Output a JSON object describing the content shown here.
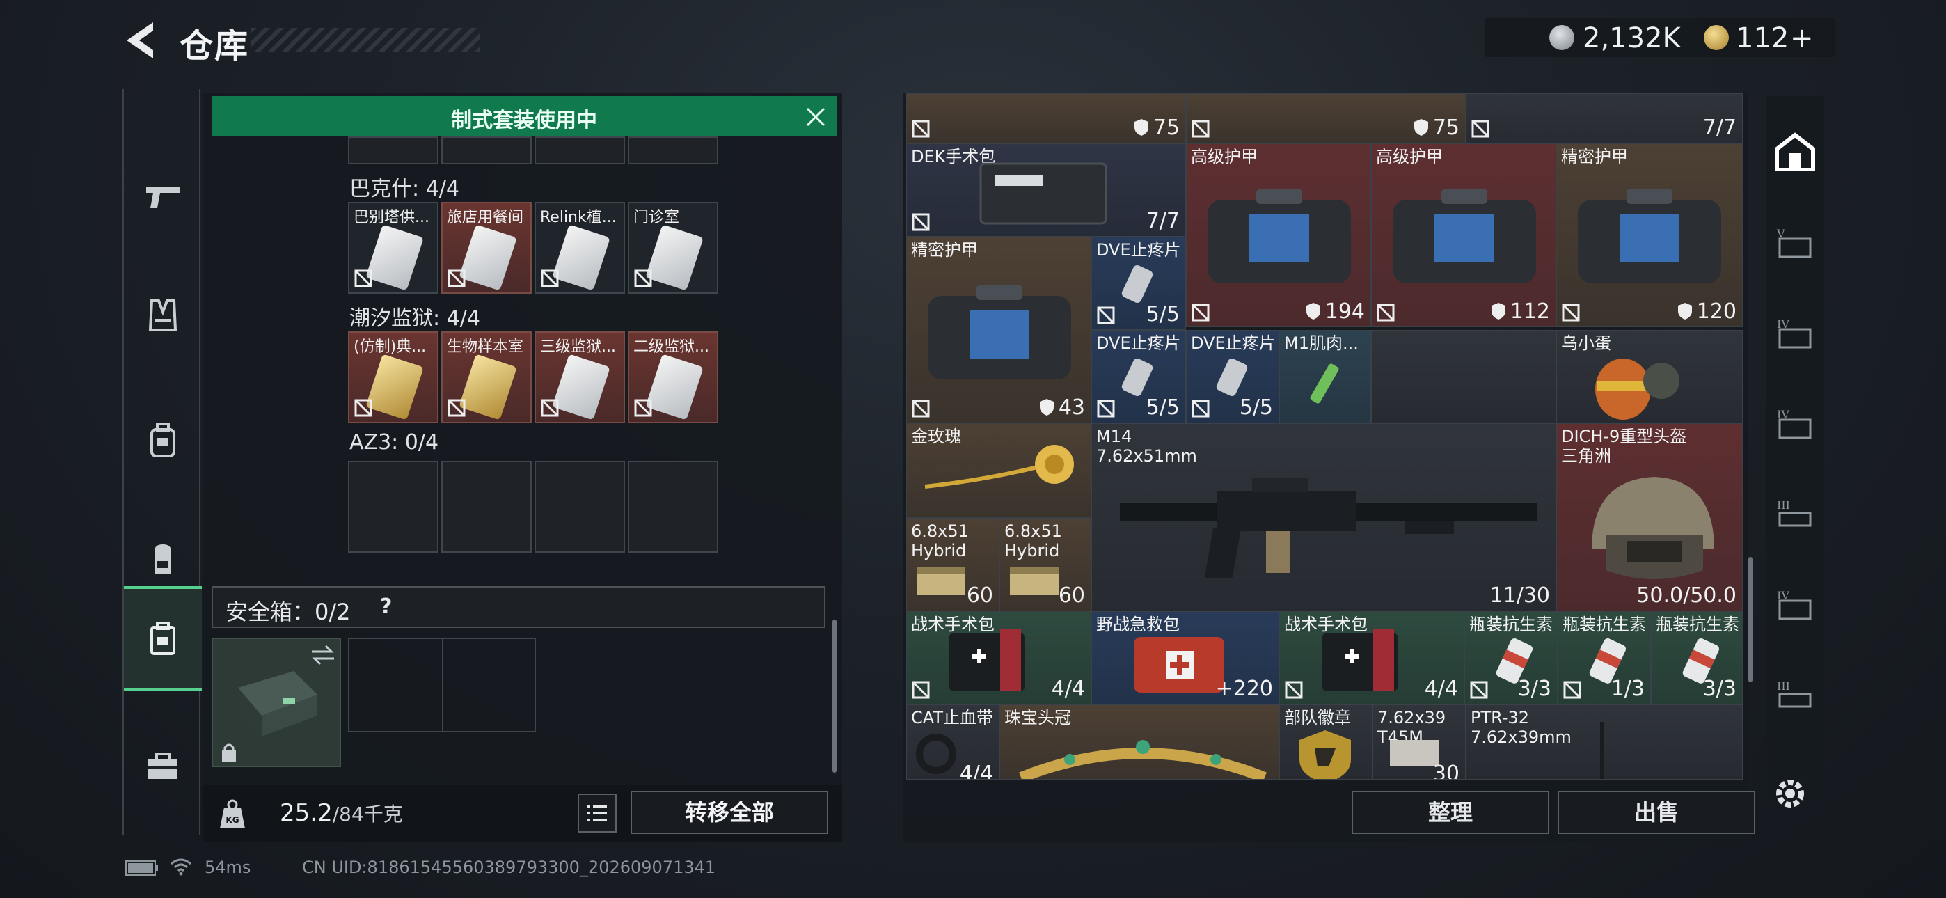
{
  "header": {
    "title": "仓库",
    "currency": [
      {
        "icon": "silver-coin-icon",
        "amount": "2,132K"
      },
      {
        "icon": "gold-coin-icon",
        "amount": "112",
        "add_symbol": "+"
      }
    ]
  },
  "left_nav": [
    {
      "icon": "pistol-icon"
    },
    {
      "icon": "vest-icon"
    },
    {
      "icon": "armor-bag-icon"
    },
    {
      "icon": "backpack-icon"
    },
    {
      "icon": "case-icon",
      "active": true
    },
    {
      "icon": "toolbox-icon"
    }
  ],
  "kit_banner": "制式套装使用中",
  "key_sections": [
    {
      "label": "巴克什: 4/4",
      "slots": [
        {
          "name": "巴别塔供...",
          "card": "silver"
        },
        {
          "name": "旅店用餐间",
          "card": "silver"
        },
        {
          "name": "Relink植...",
          "card": "silver"
        },
        {
          "name": "门诊室",
          "card": "silver"
        }
      ]
    },
    {
      "label": "潮汐监狱: 4/4",
      "slots": [
        {
          "name": "(仿制)典...",
          "card": "gold"
        },
        {
          "name": "生物样本室",
          "card": "gold"
        },
        {
          "name": "三级监狱...",
          "card": "silver"
        },
        {
          "name": "二级监狱...",
          "card": "silver"
        }
      ]
    },
    {
      "label": "AZ3: 0/4",
      "slots": []
    }
  ],
  "safe_box": {
    "label": "安全箱：0/2",
    "help": "?"
  },
  "weight": {
    "value": "25.2",
    "max": "/84千克"
  },
  "buttons": {
    "transfer_all": "转移全部",
    "sort": "整理",
    "sell": "出售"
  },
  "status": {
    "latency": "54ms",
    "uid": "CN UID:81861545560389793300_202609071341"
  },
  "storage_grid": {
    "row0": [
      {
        "qty": "75",
        "shield": true
      },
      {
        "qty": "75",
        "shield": true
      },
      {
        "qty": "7/7"
      }
    ],
    "items": [
      {
        "name": "DEK手术包",
        "qty": "7/7"
      },
      {
        "name": "高级护甲",
        "qty": "194",
        "shield": true
      },
      {
        "name": "高级护甲",
        "qty": "112",
        "shield": true
      },
      {
        "name": "精密护甲",
        "qty": "120",
        "shield": true
      },
      {
        "name": "精密护甲",
        "qty": "43",
        "shield": true
      },
      {
        "name": "DVE止疼片",
        "qty": "5/5"
      },
      {
        "name": "DVE止疼片",
        "qty": "5/5"
      },
      {
        "name": "DVE止疼片",
        "qty": "5/5"
      },
      {
        "name": "M1肌肉...",
        "qty": ""
      },
      {
        "name": "乌小蛋",
        "qty": ""
      },
      {
        "name": "金玫瑰",
        "qty": ""
      },
      {
        "name": "M14",
        "sub": "7.62x51mm",
        "qty": "11/30"
      },
      {
        "name": "DICH-9重型头盔",
        "sub": "三角洲",
        "qty": "50.0/50.0"
      },
      {
        "name": "6.8x51",
        "sub": "Hybrid",
        "qty": "60"
      },
      {
        "name": "6.8x51",
        "sub": "Hybrid",
        "qty": "60"
      },
      {
        "name": "战术手术包",
        "qty": "4/4"
      },
      {
        "name": "野战急救包",
        "qty": "220",
        "plus": "+"
      },
      {
        "name": "战术手术包",
        "qty": "4/4"
      },
      {
        "name": "瓶装抗生素",
        "qty": "3/3"
      },
      {
        "name": "瓶装抗生素",
        "qty": "1/3"
      },
      {
        "name": "瓶装抗生素",
        "qty": "3/3"
      },
      {
        "name": "CAT止血带",
        "qty": "4/4"
      },
      {
        "name": "珠宝头冠",
        "qty": ""
      },
      {
        "name": "部队徽章",
        "qty": ""
      },
      {
        "name": "7.62x39",
        "sub": "T45M",
        "qty": "30"
      },
      {
        "name": "PTR-32",
        "sub": "7.62x39mm",
        "qty": ""
      }
    ]
  },
  "right_nav": [
    {
      "icon": "warehouse-icon",
      "active": true
    },
    {
      "icon": "tier-v-container-icon"
    },
    {
      "icon": "tier-iv-container-icon"
    },
    {
      "icon": "tier-iv-container-icon"
    },
    {
      "icon": "tier-iii-container-icon"
    },
    {
      "icon": "tier-iv-container-icon"
    },
    {
      "icon": "tier-iii-container-icon"
    }
  ],
  "colors": {
    "accent_green": "#56d08f",
    "banner_green": "#117a4d",
    "rare_red": "#5e2f31",
    "legend_gold": "#c9a227"
  }
}
